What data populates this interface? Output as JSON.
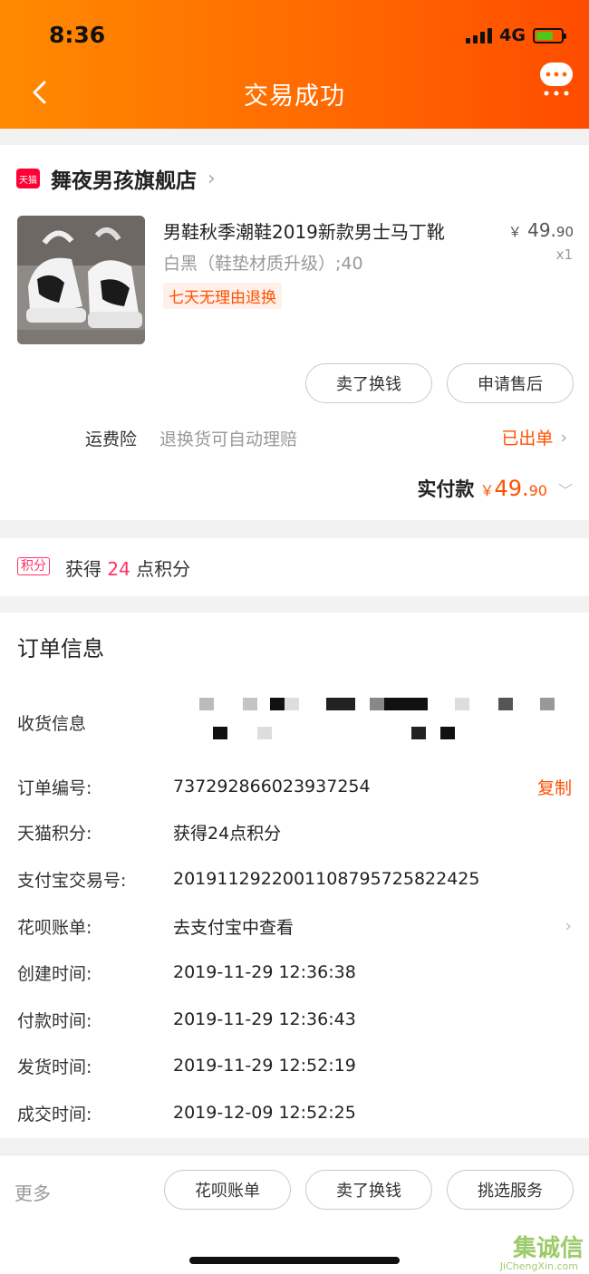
{
  "status_bar": {
    "time": "8:36",
    "network": "4G"
  },
  "header": {
    "title": "交易成功"
  },
  "store": {
    "badge": "天猫",
    "name": "舞夜男孩旗舰店",
    "product": {
      "title": "男鞋秋季潮鞋2019新款男士马丁靴",
      "sku": "白黑（鞋垫材质升级）;40",
      "tag": "七天无理由退换",
      "price_currency": "￥",
      "price_main": "49.",
      "price_decimal": "90",
      "quantity": "x1"
    },
    "buttons": {
      "sell": "卖了换钱",
      "after_sale": "申请售后"
    },
    "insurance": {
      "label": "运费险",
      "desc": "退换货可自动理赔",
      "status": "已出单"
    },
    "total": {
      "label": "实付款",
      "currency": "￥",
      "main": "49.",
      "decimal": "90"
    }
  },
  "points": {
    "badge": "积分",
    "prefix": "获得",
    "amount": "24",
    "suffix": "点积分"
  },
  "order_info": {
    "title": "订单信息",
    "shipping_label": "收货信息",
    "rows": [
      {
        "label": "订单编号:",
        "value": "737292866023937254",
        "action": "复制"
      },
      {
        "label": "天猫积分:",
        "value": "获得24点积分"
      },
      {
        "label": "支付宝交易号:",
        "value": "2019112922001108795725822425"
      },
      {
        "label": "花呗账单:",
        "value": "去支付宝中查看"
      },
      {
        "label": "创建时间:",
        "value": "2019-11-29 12:36:38"
      },
      {
        "label": "付款时间:",
        "value": "2019-11-29 12:36:43"
      },
      {
        "label": "发货时间:",
        "value": "2019-11-29 12:52:19"
      },
      {
        "label": "成交时间:",
        "value": "2019-12-09 12:52:25"
      }
    ]
  },
  "bottom_bar": {
    "more": "更多",
    "buttons": [
      "花呗账单",
      "卖了换钱",
      "挑选服务"
    ]
  },
  "watermark": {
    "text": "集诚信",
    "sub": "JiChengXin.com"
  },
  "colors": {
    "accent": "#ff5000",
    "header_start": "#ff8a00",
    "header_end": "#ff4c00",
    "points": "#ff3366"
  }
}
